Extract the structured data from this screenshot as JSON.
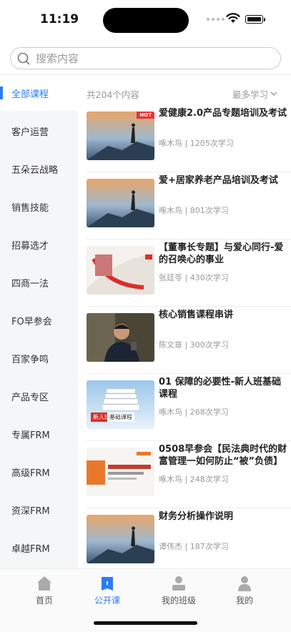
{
  "status": {
    "time": "11:19"
  },
  "search": {
    "placeholder": "搜索内容"
  },
  "sidebar": {
    "items": [
      {
        "label": "全部课程"
      },
      {
        "label": "客户运营"
      },
      {
        "label": "五朵云战略"
      },
      {
        "label": "销售技能"
      },
      {
        "label": "招募选才"
      },
      {
        "label": "四商一法"
      },
      {
        "label": "FO早参会"
      },
      {
        "label": "百家争鸣"
      },
      {
        "label": "产品专区"
      },
      {
        "label": "专属FRM"
      },
      {
        "label": "高级FRM"
      },
      {
        "label": "资深FRM"
      },
      {
        "label": "卓越FRM"
      }
    ]
  },
  "list": {
    "count": "共204个内容",
    "sort": "最多学习",
    "courses": [
      {
        "title": "爱健康2.0产品专题培训及考试",
        "meta": "啄木鸟 | 1205次学习",
        "badge": "HOT"
      },
      {
        "title": "爱+居家养老产品培训及考试",
        "meta": "啄木鸟 | 801次学习"
      },
      {
        "title": "【董事长专题】与爱心同行-爱的召唤心的事业",
        "meta": "张廷苓 | 430次学习"
      },
      {
        "title": "核心销售课程串讲",
        "meta": "陈文章 | 300次学习"
      },
      {
        "title": "01 保障的必要性-新人班基础课程",
        "meta": "啄木鸟 | 268次学习",
        "badge": "新人班",
        "badge2": "基础课程"
      },
      {
        "title": "0508早参会【民法典时代的财富管理一如何防止“被”负债】",
        "meta": "啄木鸟 | 248次学习"
      },
      {
        "title": "财务分析操作说明",
        "meta": "谭伟杰 | 187次学习"
      }
    ]
  },
  "tabbar": {
    "tabs": [
      {
        "label": "首页"
      },
      {
        "label": "公开课"
      },
      {
        "label": "我的班级"
      },
      {
        "label": "我的"
      }
    ]
  },
  "colors": {
    "accent": "#2f7bf5"
  }
}
